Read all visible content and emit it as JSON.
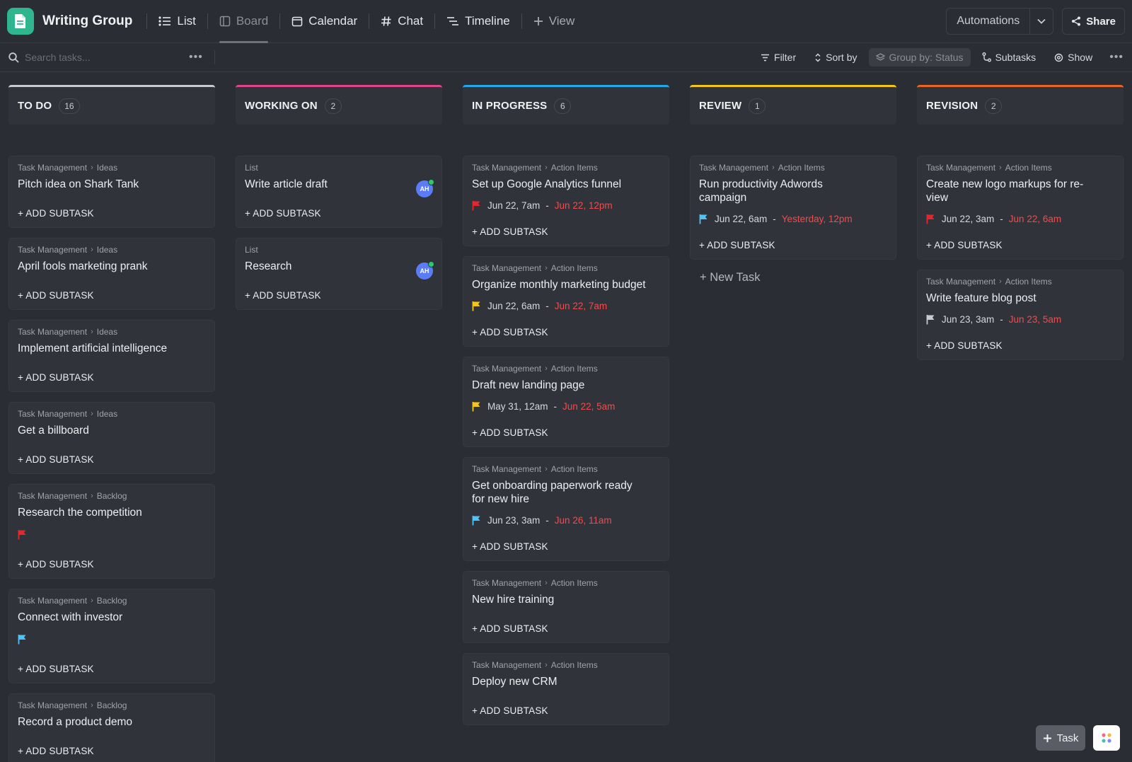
{
  "app": {
    "title": "Writing Group"
  },
  "nav": {
    "list": "List",
    "board": "Board",
    "calendar": "Calendar",
    "chat": "Chat",
    "timeline": "Timeline",
    "add_view": "View"
  },
  "topbar": {
    "automations": "Automations",
    "share": "Share"
  },
  "toolbar": {
    "search_placeholder": "Search tasks...",
    "filter": "Filter",
    "sort": "Sort by",
    "group": "Group by: Status",
    "subtasks": "Subtasks",
    "show": "Show"
  },
  "colors": {
    "todo": "#c9cbd0",
    "working": "#e0448c",
    "in_progress": "#1fa9e6",
    "review": "#f5c518",
    "revision": "#e8661d",
    "flag_red": "#e5262b",
    "flag_yellow": "#f5c518",
    "flag_blue": "#4fc3f7",
    "flag_gray": "#c9cbd0"
  },
  "add_subtask": "+ ADD SUBTASK",
  "columns": [
    {
      "title": "TO DO",
      "count": "16",
      "cards": [
        {
          "crumb1": "Task Management",
          "crumb2": "Ideas",
          "title": "Pitch idea on Shark Tank"
        },
        {
          "crumb1": "Task Management",
          "crumb2": "Ideas",
          "title": "April fools marketing prank"
        },
        {
          "crumb1": "Task Management",
          "crumb2": "Ideas",
          "title": "Implement artificial intelligence"
        },
        {
          "crumb1": "Task Management",
          "crumb2": "Ideas",
          "title": "Get a billboard"
        },
        {
          "crumb1": "Task Management",
          "crumb2": "Backlog",
          "title": "Research the competition",
          "flag": "red-flag-icon"
        },
        {
          "crumb1": "Task Management",
          "crumb2": "Backlog",
          "title": "Connect with investor",
          "flag": "blue-flag-icon"
        },
        {
          "crumb1": "Task Management",
          "crumb2": "Backlog",
          "title": "Record a product demo"
        }
      ]
    },
    {
      "title": "WORKING ON",
      "count": "2",
      "cards": [
        {
          "crumb1": "List",
          "title": "Write article draft",
          "avatar": "AH"
        },
        {
          "crumb1": "List",
          "title": "Research",
          "avatar": "AH"
        }
      ]
    },
    {
      "title": "IN PROGRESS",
      "count": "6",
      "cards": [
        {
          "crumb1": "Task Management",
          "crumb2": "Action Items",
          "title": "Set up Google Analytics funnel",
          "start": "Jun 22, 7am",
          "due": "Jun 22, 12pm"
        },
        {
          "crumb1": "Task Management",
          "crumb2": "Action Items",
          "title": "Organize monthly marketing budget",
          "start": "Jun 22, 6am",
          "due": "Jun 22, 7am"
        },
        {
          "crumb1": "Task Management",
          "crumb2": "Action Items",
          "title": "Draft new landing page",
          "start": "May 31, 12am",
          "due": "Jun 22, 5am"
        },
        {
          "crumb1": "Task Management",
          "crumb2": "Action Items",
          "title": "Get onboarding paperwork ready for new hire",
          "start": "Jun 23, 3am",
          "due": "Jun 26, 11am"
        },
        {
          "crumb1": "Task Management",
          "crumb2": "Action Items",
          "title": "New hire training"
        },
        {
          "crumb1": "Task Management",
          "crumb2": "Action Items",
          "title": "Deploy new CRM"
        }
      ]
    },
    {
      "title": "REVIEW",
      "count": "1",
      "cards": [
        {
          "crumb1": "Task Management",
          "crumb2": "Action Items",
          "title": "Run productivity Adwords campaign",
          "start": "Jun 22, 6am",
          "due": "Yesterday, 12pm"
        }
      ],
      "new_task": "+ New Task"
    },
    {
      "title": "REVISION",
      "count": "2",
      "cards": [
        {
          "crumb1": "Task Management",
          "crumb2": "Action Items",
          "title": "Create new logo markups for re-view",
          "start": "Jun 22, 3am",
          "due": "Jun 22, 6am"
        },
        {
          "crumb1": "Task Management",
          "crumb2": "Action Items",
          "title": "Write feature blog post",
          "start": "Jun 23, 3am",
          "due": "Jun 23, 5am"
        }
      ]
    }
  ],
  "fab": {
    "task": "Task"
  }
}
